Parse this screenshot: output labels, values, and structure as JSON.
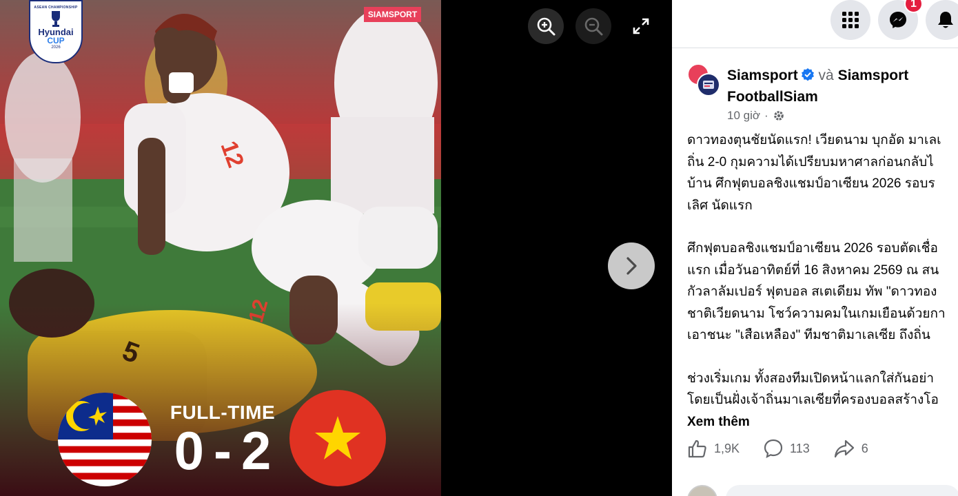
{
  "photo": {
    "watermark": "SIAMSPORT",
    "logo_top": "ASEAN CHAMPIONSHIP",
    "logo_brand": "Hyundai",
    "logo_cup": "CUP",
    "logo_year": "2026",
    "scoreboard": {
      "status": "FULL-TIME",
      "home_score": "0",
      "separator": "-",
      "away_score": "2"
    }
  },
  "viewer_controls": {
    "zoom_in_icon": "zoom-in-icon",
    "zoom_out_icon": "zoom-out-icon",
    "fullscreen_icon": "fullscreen-icon",
    "next_icon": "chevron-right-icon"
  },
  "topbar": {
    "notification_count": "1"
  },
  "post": {
    "page_name": "Siamsport",
    "conjunction": "và",
    "coauthor_name_line1": "Siamsport",
    "coauthor_name_line2": "FootballSiam",
    "time": "10 giờ",
    "time_dot": "·",
    "paragraphs": [
      [
        "ดาวทองตุนชัยนัดแรก! เวียดนาม บุกอัด มาเลเ",
        "ถิ่น 2-0 กุมความได้เปรียบมหาศาลก่อนกลับไ",
        "บ้าน ศึกฟุตบอลชิงแชมป์อาเซียน 2026 รอบร",
        "เลิศ นัดแรก"
      ],
      [
        "ศึกฟุตบอลชิงแชมป์อาเซียน 2026 รอบตัดเชื่อ",
        "แรก เมื่อวันอาทิตย์ที่ 16 สิงหาคม 2569 ณ สน",
        "กัวลาลัมเปอร์ ฟุตบอล สเตเดียม ทัพ \"ดาวทอง",
        "ชาติเวียดนาม โชว์ความคมในเกมเยือนด้วยกา",
        "เอาชนะ \"เสือเหลือง\" ทีมชาติมาเลเซีย ถึงถิ่น"
      ],
      [
        "ช่วงเริ่มเกม ทั้งสองทีมเปิดหน้าแลกใส่กันอย่า",
        "โดยเป็นฝั่งเจ้าถิ่นมาเลเซียที่ครองบอลสร้างโอ"
      ]
    ],
    "see_more": "Xem thêm",
    "likes": "1,9K",
    "comments": "113",
    "shares": "6"
  },
  "colors": {
    "facebook_blue": "#1877f2",
    "notification_red": "#e41e3f",
    "malaysia_blue": "#0d2c8c",
    "malaysia_red": "#cc0001",
    "vietnam_red": "#e03222",
    "vietnam_star": "#ffd500",
    "siamsport_red": "#e8405a"
  }
}
